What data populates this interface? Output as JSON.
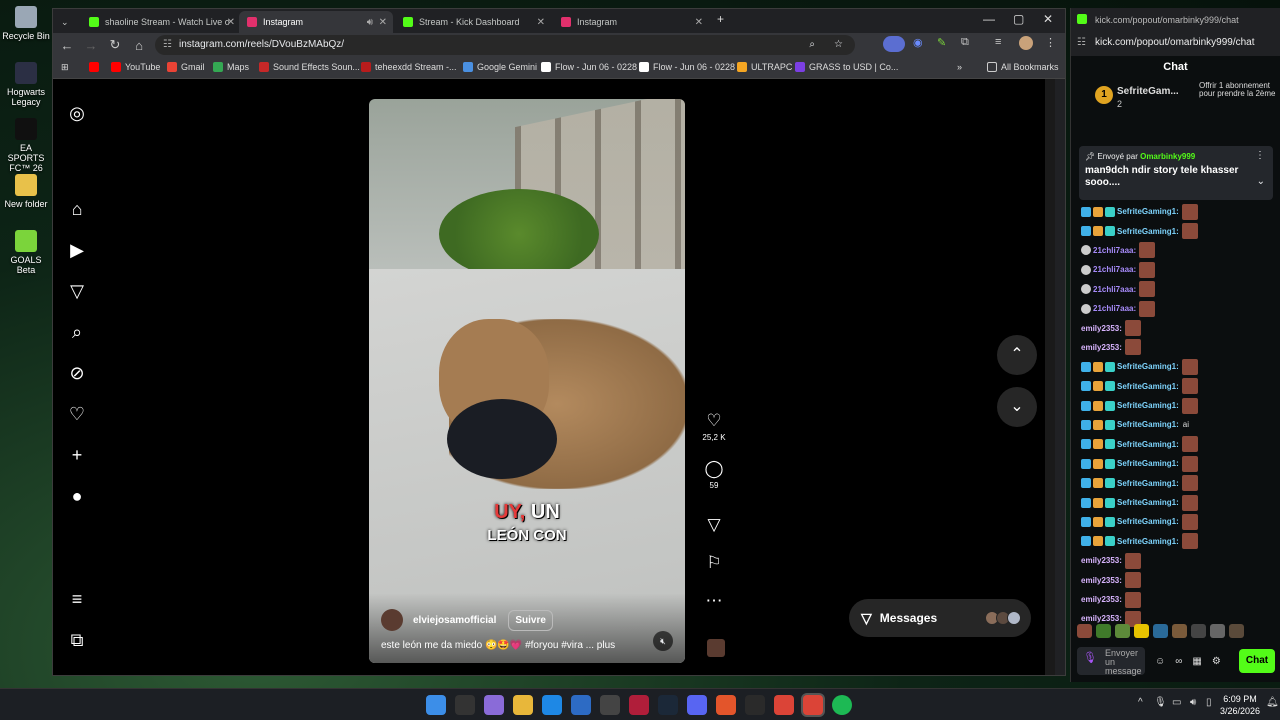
{
  "desktop": {
    "icons": [
      "Recycle Bin",
      "Hogwarts Legacy",
      "EA SPORTS FC™ 26",
      "New folder",
      "GOALS Beta"
    ]
  },
  "browser": {
    "tabs": [
      {
        "title": "shaoline Stream - Watch Live o",
        "color": "#53fc18"
      },
      {
        "title": "Instagram",
        "color": "#e1306c"
      },
      {
        "title": "Stream - Kick Dashboard",
        "color": "#53fc18"
      },
      {
        "title": "Instagram",
        "color": "#e1306c"
      }
    ],
    "new_tab": "+",
    "url": "instagram.com/reels/DVouBzMAbQz/",
    "bookmarks": [
      "YouTube",
      "Gmail",
      "Maps",
      "Sound Effects Soun...",
      "teheexdd Stream -...",
      "Google Gemini",
      "Flow - Jun 06 - 0228",
      "Flow - Jun 06 - 0228",
      "ULTRAPC",
      "GRASS to USD | Co..."
    ],
    "all_bookmarks": "All Bookmarks"
  },
  "reel": {
    "caption_red": "UY,",
    "caption_white": " UN",
    "caption_line2": "LEÓN CON",
    "author": "elviejosamofficial",
    "follow": "Suivre",
    "description": "este león me da miedo 😳🤩💗 #foryou #vira ... plus",
    "likes": "25,2 K",
    "comments": "59"
  },
  "messages_label": "Messages",
  "chat": {
    "title": "kick.com/popout/omarbinky999/chat",
    "url": "kick.com/popout/omarbinky999/chat",
    "header": "Chat",
    "gifter": "SefriteGam...",
    "gift_count": "2",
    "gift_badge": "1",
    "offer": "Offrir 1 abonnement pour prendre la 2ème",
    "pinned_by": "Envoyé par",
    "pinned_user": "Omarbinky999",
    "pinned_msg": "man9dch ndir story tele khasser sooo....",
    "messages": [
      {
        "user": "SefriteGaming1:",
        "color": "#7dd3fc",
        "text": ""
      },
      {
        "user": "SefriteGaming1:",
        "color": "#7dd3fc",
        "text": ""
      },
      {
        "user": "21chli7aaa:",
        "color": "#a78bfa",
        "text": ""
      },
      {
        "user": "21chli7aaa:",
        "color": "#a78bfa",
        "text": ""
      },
      {
        "user": "21chli7aaa:",
        "color": "#a78bfa",
        "text": ""
      },
      {
        "user": "21chli7aaa:",
        "color": "#a78bfa",
        "text": ""
      },
      {
        "user": "emily2353:",
        "color": "#d8b4fe",
        "text": ""
      },
      {
        "user": "emily2353:",
        "color": "#d8b4fe",
        "text": ""
      },
      {
        "user": "SefriteGaming1:",
        "color": "#7dd3fc",
        "text": ""
      },
      {
        "user": "SefriteGaming1:",
        "color": "#7dd3fc",
        "text": ""
      },
      {
        "user": "SefriteGaming1:",
        "color": "#7dd3fc",
        "text": ""
      },
      {
        "user": "SefriteGaming1:",
        "color": "#7dd3fc",
        "text": "ai"
      },
      {
        "user": "SefriteGaming1:",
        "color": "#7dd3fc",
        "text": ""
      },
      {
        "user": "SefriteGaming1:",
        "color": "#7dd3fc",
        "text": ""
      },
      {
        "user": "SefriteGaming1:",
        "color": "#7dd3fc",
        "text": ""
      },
      {
        "user": "SefriteGaming1:",
        "color": "#7dd3fc",
        "text": ""
      },
      {
        "user": "SefriteGaming1:",
        "color": "#7dd3fc",
        "text": ""
      },
      {
        "user": "SefriteGaming1:",
        "color": "#7dd3fc",
        "text": ""
      },
      {
        "user": "emily2353:",
        "color": "#d8b4fe",
        "text": ""
      },
      {
        "user": "emily2353:",
        "color": "#d8b4fe",
        "text": ""
      },
      {
        "user": "emily2353:",
        "color": "#d8b4fe",
        "text": ""
      },
      {
        "user": "emily2353:",
        "color": "#d8b4fe",
        "text": ""
      }
    ],
    "input_placeholder": "Envoyer un message",
    "send": "Chat"
  },
  "taskbar": {
    "time": "6:09 PM",
    "date": "3/26/2026",
    "lang": "^"
  }
}
